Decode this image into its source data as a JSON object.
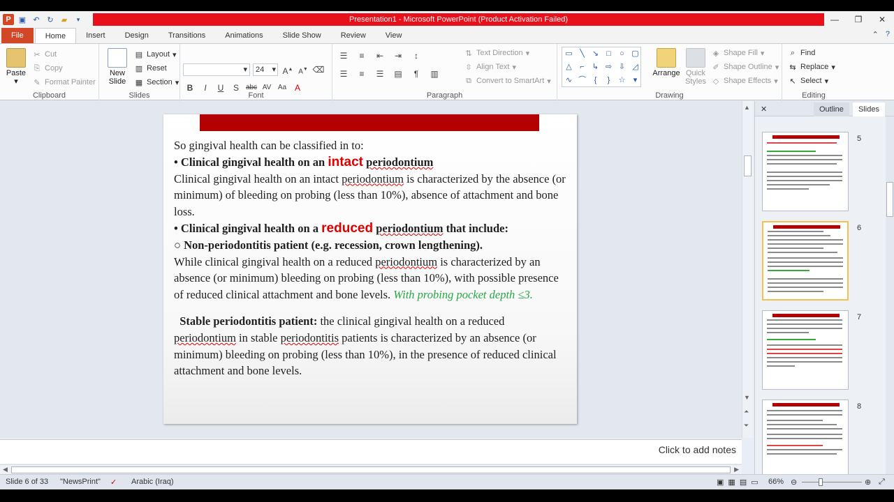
{
  "window": {
    "title": "Presentation1  -  Microsoft PowerPoint (Product Activation Failed)"
  },
  "tabs": [
    "File",
    "Home",
    "Insert",
    "Design",
    "Transitions",
    "Animations",
    "Slide Show",
    "Review",
    "View"
  ],
  "ribbon": {
    "clipboard": {
      "paste": "Paste",
      "cut": "Cut",
      "copy": "Copy",
      "format_painter": "Format Painter",
      "label": "Clipboard"
    },
    "slides": {
      "new_slide": "New Slide",
      "layout": "Layout",
      "reset": "Reset",
      "section": "Section",
      "label": "Slides"
    },
    "font": {
      "size": "24",
      "label": "Font"
    },
    "paragraph": {
      "text_direction": "Text Direction",
      "align_text": "Align Text",
      "convert": "Convert to SmartArt",
      "label": "Paragraph"
    },
    "drawing": {
      "arrange": "Arrange",
      "quick_styles": "Quick Styles",
      "shape_fill": "Shape Fill",
      "shape_outline": "Shape Outline",
      "shape_effects": "Shape Effects",
      "label": "Drawing"
    },
    "editing": {
      "find": "Find",
      "replace": "Replace",
      "select": "Select",
      "label": "Editing"
    }
  },
  "slide": {
    "intro": "So gingival health can be classified in to:",
    "h1_a": "• Clinical gingival health on an ",
    "h1_red": "intact",
    "h1_b": "periodontium",
    "p1_a": "Clinical gingival health on an intact ",
    "p1_sq": "periodontium",
    "p1_b": " is characterized by the absence (or minimum) of bleeding on probing (less than 10%), absence of attachment and bone loss.",
    "h2_a": "• Clinical gingival health on a ",
    "h2_red": "reduced",
    "h2_b": "periodontium",
    "h2_c": " that include:",
    "h3": "○  Non-periodontitis  patient (e.g. recession, crown lengthening).",
    "p2_a": "While clinical gingival health on a reduced ",
    "p2_sq": "periodontium",
    "p2_b": " is characterized by an absence (or minimum) bleeding on probing (less than 10%), with possible presence of reduced clinical attachment and bone levels. ",
    "p2_green": "With probing pocket depth ≤3.",
    "h4": "Stable periodontitis patient:",
    "p3_a": " the clinical gingival health on a reduced ",
    "p3_sq1": "periodontium",
    "p3_b": " in stable ",
    "p3_sq2": "periodontitis",
    "p3_c": " patients is characterized by an absence (or minimum) bleeding on probing (less than 10%), in the presence of reduced clinical attachment and bone levels."
  },
  "notes": {
    "placeholder": "Click to add notes"
  },
  "pane": {
    "tab_outline": "Outline",
    "tab_slides": "Slides",
    "thumb_numbers": [
      "5",
      "6",
      "7",
      "8"
    ]
  },
  "status": {
    "slide": "Slide 6 of 33",
    "theme": "\"NewsPrint\"",
    "language": "Arabic (Iraq)",
    "zoom": "66%"
  },
  "colors": {
    "title_red": "#e8101a",
    "file_tab": "#d24726",
    "slide_bar": "#b30000",
    "accent_green": "#28a745"
  }
}
